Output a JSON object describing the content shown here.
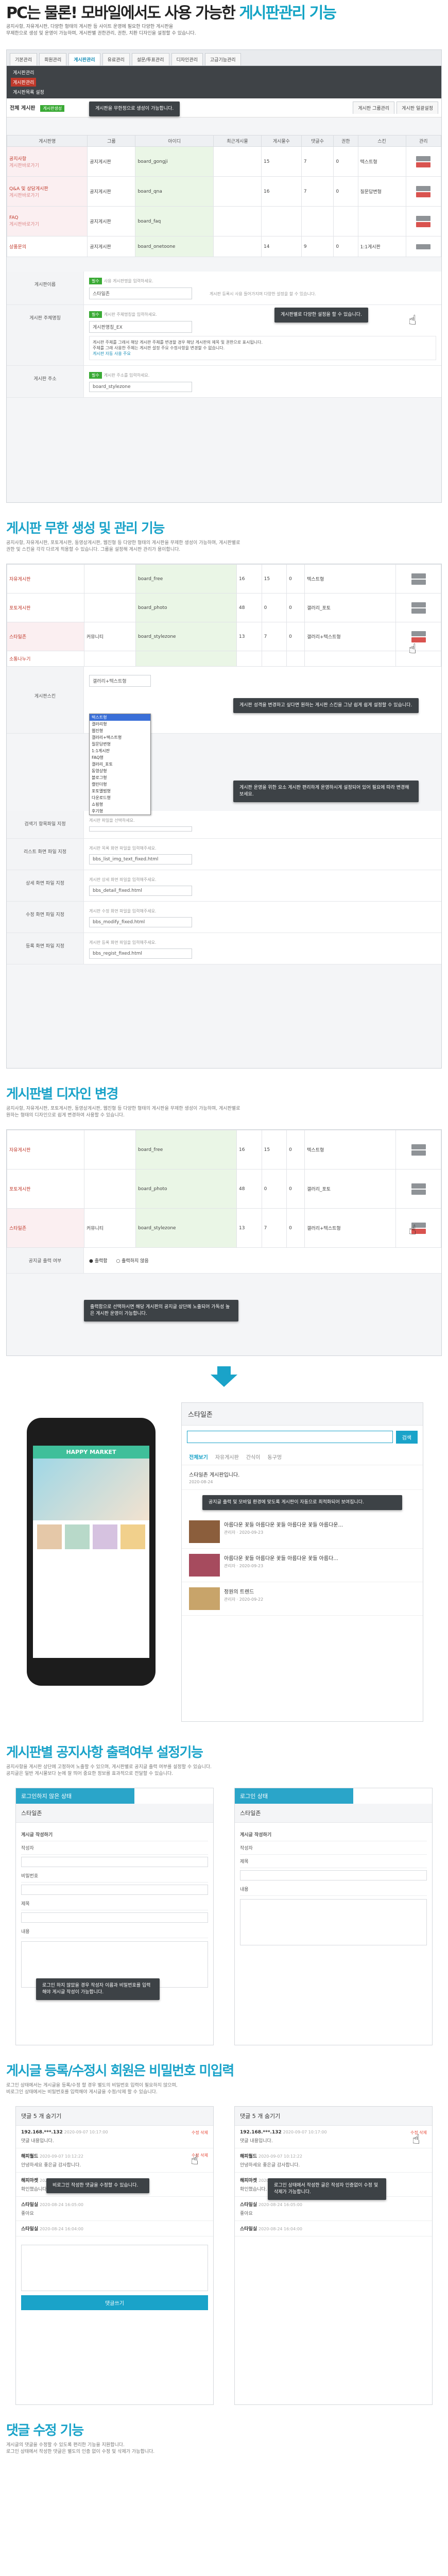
{
  "hero": {
    "title_prefix": "PC는 물론! 모바일에서도 사용 가능한 ",
    "title_highlight": "게시판관리 기능",
    "desc": [
      "공지사항, 자유게시판, 다양한 형태의 게시판 등 사이트 운영에 필요한 다양한 게시판을",
      "무제한으로 생성 및 운영이 가능하며, 게시판별 권한관리, 권한, 치환 디자인을 설정할 수 있습니다."
    ]
  },
  "admin1": {
    "tabs": [
      "기본관리",
      "회원관리",
      "게시판관리",
      "유료관리",
      "설문/투표관리",
      "디자인관리",
      "고급기능관리"
    ],
    "active_tab": 2,
    "menu": [
      "게시판관리",
      "게시판관리",
      "게시판목록 설정"
    ],
    "toolbar_label": "전체 게시판",
    "toolbar_badge": "게시판생성",
    "toolbar_right": [
      "게시판 그룹관리",
      "게시판 일괄설정"
    ],
    "callout_top": "게시판을 무한정으로 생성이 가능합니다.",
    "headers": [
      "게시판명",
      "그룹",
      "아이디",
      "최근게시물",
      "게시물수",
      "댓글수",
      "권한",
      "스킨",
      "관리"
    ],
    "rows": [
      {
        "name": "공지사항",
        "sub": "게시판바로가기",
        "group": "공지게시판",
        "id": "board_gongji",
        "a": "15",
        "b": "7",
        "c": "0",
        "skin": "텍스트형"
      },
      {
        "name": "Q&A 및 상담게시판",
        "sub": "게시판바로가기",
        "group": "공지게시판",
        "id": "board_qna",
        "a": "16",
        "b": "7",
        "c": "0",
        "skin": "질문답변형"
      },
      {
        "name": "FAQ",
        "sub": "게시판바로가기",
        "group": "공지게시판",
        "id": "board_faq",
        "a": "",
        "b": "",
        "c": "",
        "skin": ""
      },
      {
        "name": "상품문의",
        "sub": "",
        "group": "공지게시판",
        "id": "board_onetoone",
        "a": "14",
        "b": "9",
        "c": "0",
        "skin": "1:1게시판"
      }
    ],
    "callout_mid": "게시판별로 다양한 설정을 할 수 있습니다.",
    "form": [
      {
        "label": "게시판이름",
        "tag": "필수",
        "help": "사용 게시판명을 입력하세요.",
        "value": "스타일존",
        "note": "게시판 등록시 사용 들어가지며 다양한 설정을 할 수 있습니다."
      },
      {
        "label": "게시판 주체명칭",
        "tag": "필수",
        "help": "게시판 주체명칭을 입력하세요.",
        "value": "게시판명칭_EX",
        "note": "게시판 운영에 주체로 적용 - 게시판 소개 제목 사용됩니다."
      },
      {
        "label": "게시판 주소",
        "tag": "필수",
        "help": "게시판 주소를 입력하세요.",
        "value": "board_stylezone",
        "note": ""
      }
    ],
    "notice_lines": [
      "게시판 주체를 그래서 해당 게시판 주체를 변경할 경우 해당 게시판의 제목 및 권한으로 표시됩니다.",
      "주체를 그래 사용한 주체는 게시판 설정 주요 수정사항을 변경할 수 없습니다."
    ],
    "notice_link": "게시판 자동 사용 주요"
  },
  "sec2": {
    "title": "게시판 무한 생성 및 관리 기능",
    "desc": [
      "공지사항, 자유게시판, 포토게시판, 동영상게시판, 웹진형 등 다양한 형태의 게시판을 무제한 생성이 가능하며, 게시판별로",
      "권한 및 스킨을 각각 다르게 적용할 수 있습니다. 그룹을 설정해 게시판 관리가 용이합니다."
    ],
    "rows": [
      {
        "name": "자유게시판",
        "group": "",
        "id": "board_free",
        "a": "16",
        "b": "15",
        "c": "0",
        "skin": "텍스트형"
      },
      {
        "name": "포토게시판",
        "group": "",
        "id": "board_photo",
        "a": "48",
        "b": "0",
        "c": "0",
        "skin": "갤러리_포토"
      },
      {
        "name": "스타일존",
        "group": "커뮤니티",
        "id": "board_stylezone",
        "a": "13",
        "b": "7",
        "c": "0",
        "skin": "갤러리+텍스트형"
      },
      {
        "name": "소통나누기",
        "group": "",
        "id": "",
        "a": "",
        "b": "",
        "c": "",
        "skin": ""
      }
    ],
    "skin_label": "게시판스킨",
    "skin_select": "갤러리+텍스트형",
    "skin_options": [
      "텍스트형",
      "갤러리형",
      "웹진형",
      "갤러리+텍스트형",
      "질문답변형",
      "1:1게시판",
      "FAQ형",
      "갤러리_포토",
      "동영상형",
      "블로그형",
      "캘린더형",
      "포토앨범형",
      "다운로드형",
      "쇼핑형",
      "후기형"
    ],
    "callouts": [
      "게시판 성격을 변경하고 싶다면 원하는 게시판 스킨을 그냥 쉽게 쉽게 설정할 수 있습니다.",
      "게시판 운영을 위한 요소 게시판 편리하게 운영하시게 설정되어 있어 필요에 따라 변경해 보세요."
    ],
    "file_rows": [
      {
        "label": "검색기 항목파일 지정",
        "value": "",
        "help": "게시판 파일을 선택하세요."
      },
      {
        "label": "리스트 화면 파일 지정",
        "value": "bbs_list_img_text_fixed.html",
        "help": "게시판 목록 화면 파일을 입력해주세요."
      },
      {
        "label": "상세 화면 파일 지정",
        "value": "bbs_detail_fixed.html",
        "help": "게시판 상세 화면 파일을 입력해주세요."
      },
      {
        "label": "수정 화면 파일 지정",
        "value": "bbs_modify_fixed.html",
        "help": "게시판 수정 화면 파일을 입력해주세요."
      },
      {
        "label": "등록 화면 파일 지정",
        "value": "bbs_regist_fixed.html",
        "help": "게시판 등록 화면 파일을 입력해주세요."
      }
    ]
  },
  "sec3": {
    "title": "게시판별 디자인 변경",
    "desc": [
      "공지사항, 자유게시판, 포토게시판, 동영상게시판, 웹진형 등 다양한 형태의 게시판을 무제한 생성이 가능하며, 게시판별로",
      "원하는 형태의 디자인으로 쉽게 변경하여 사용할 수 있습니다."
    ],
    "rows": [
      {
        "name": "자유게시판",
        "group": "",
        "id": "board_free",
        "a": "16",
        "b": "15",
        "c": "0",
        "skin": "텍스트형"
      },
      {
        "name": "포토게시판",
        "group": "",
        "id": "board_photo",
        "a": "48",
        "b": "0",
        "c": "0",
        "skin": "갤러리_포토"
      },
      {
        "name": "스타일존",
        "group": "커뮤니티",
        "id": "board_stylezone",
        "a": "13",
        "b": "7",
        "c": "0",
        "skin": "갤러리+텍스트형"
      }
    ],
    "toggle_label": "공지글 출력 여부",
    "radio_on": "출력함",
    "radio_off": "출력하지 않음",
    "callout": "출력함으로 선택하시면 해당 게시판의 공지글 상단에 노출되어 가독성 높은 게시판 운영이 가능합니다."
  },
  "mobile": {
    "brand": "HAPPY MARKET",
    "panel_title": "스타일존",
    "search_btn": "검색",
    "tabs": [
      "전체보기",
      "자유게시판",
      "간식이",
      "동구멍"
    ],
    "notice": "스타일존 게시판입니다.",
    "notice_date": "2020-08-24",
    "callout": "공지글 출력 및 모바일 환경에 맞도록 게시판이 자동으로 최적화되어 보여집니다.",
    "posts": [
      {
        "title": "아름다운 꽃들 아름다운 꽃들 아름다운 꽃들 아름다운...",
        "author": "관리자",
        "date": "2020-09-23"
      },
      {
        "title": "아름다운 꽃들 아름다운 꽃들 아름다운 꽃들 아름다...",
        "author": "관리자",
        "date": "2020-09-23"
      },
      {
        "title": "정원의 트렌드",
        "author": "관리자",
        "date": "2020-09-22"
      }
    ]
  },
  "sec4": {
    "title": "게시판별 공지사항 출력여부 설정기능",
    "desc": [
      "공지사항을 게시판 상단에 고정하여 노출할 수 있으며, 게시판별로 공지글 출력 여부를 설정할 수 있습니다.",
      "공지글은 일반 게시물보다 눈에 잘 띄어 중요한 정보를 효과적으로 전달할 수 있습니다."
    ],
    "card_left": {
      "head": "로그인하지 않은 상태",
      "sub": "스타일존",
      "lines": [
        "게시글 작성하기",
        "작성자",
        "비밀번호",
        "제목",
        "내용"
      ],
      "callout": "로그인 하지 않았을 경우 작성자 이름과 비밀번호를 입력해야 게시글 작성이 가능합니다."
    },
    "card_right": {
      "head": "로그인 상태",
      "sub": "스타일존",
      "lines": [
        "게시글 작성하기",
        "작성자",
        "제목",
        "내용"
      ]
    }
  },
  "sec5": {
    "title": "게시글 등록/수정시 회원은 비밀번호 미입력",
    "desc": [
      "로그인 상태에서는 게시글을 등록/수정 할 경우 별도의 비밀번호 입력이 필요하지 않으며,",
      "비로그인 상태에서는 비밀번호를 입력해야 게시글을 수정/삭제 할 수 있습니다."
    ],
    "comments_left_title": "댓글 5 개 숨기기",
    "comments_right_title": "댓글 5 개 숨기기",
    "comments": [
      {
        "who": "192.168.***.132",
        "when": "2020-09-07 10:17:00",
        "txt": "댓글 내용입니다."
      },
      {
        "who": "해피월드",
        "when": "2020-09-07 10:12:22",
        "txt": "안녕하세요 좋은글 감사합니다."
      },
      {
        "who": "해피마켓",
        "when": "2020-08-24 16:06:00",
        "txt": "확인했습니다."
      },
      {
        "who": "스타일실",
        "when": "2020-08-24 16:05:00",
        "txt": "좋아요"
      },
      {
        "who": "스타일실",
        "when": "2020-08-24 16:04:00",
        "txt": ""
      }
    ],
    "act_label": "수정 삭제",
    "callout_left": "비로그인 작성한 댓글을 수정할 수 있습니다.",
    "callout_right": "로그인 상태에서 작성한 글은 작성자 인증없이 수정 및 삭제가 가능합니다.",
    "submit": "댓글쓰기"
  },
  "sec6": {
    "title": "댓글 수정 기능",
    "desc": [
      "게시글의 댓글을 수정할 수 있도록 편리한 기능을 지원합니다.",
      "로그인 상태에서 작성한 댓글은 별도의 인증 없이 수정 및 삭제가 가능합니다."
    ]
  }
}
